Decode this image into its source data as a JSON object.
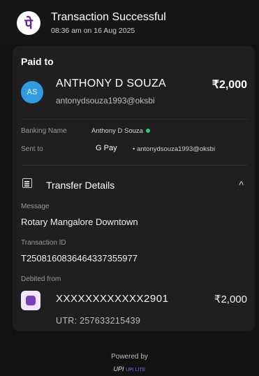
{
  "header": {
    "title": "Transaction Successful",
    "datetime": "08:36 am on 16 Aug 2025",
    "logo_letter": "पे",
    "logo_icon": "phonepe-logo-icon"
  },
  "paid_to": {
    "label": "Paid to",
    "avatar_initials": "AS",
    "name": "ANTHONY D SOUZA",
    "vpa": "antonydsouza1993@oksbi",
    "amount": "₹2,000"
  },
  "details": {
    "banking_name_label": "Banking Name",
    "banking_name_value": "Anthony D Souza",
    "sent_to_label": "Sent to",
    "sent_to_app": "G Pay",
    "sent_to_vpa": "• antonydsouza1993@oksbi"
  },
  "transfer": {
    "title": "Transfer Details",
    "chevron": "^",
    "message_label": "Message",
    "message_value": "Rotary Mangalore Downtown",
    "txn_id_label": "Transaction ID",
    "txn_id_value": "T2508160836464337355977",
    "debited_label": "Debited from",
    "account": "XXXXXXXXXXXX2901",
    "debit_amount": "₹2,000",
    "utr": "UTR: 257633215439"
  },
  "footer": {
    "powered_by": "Powered by",
    "upi_text": "UPI",
    "upi_sub": "UPI LITE"
  },
  "colors": {
    "background": "#121212",
    "card": "#1f1f1f",
    "avatar": "#2f9be0",
    "brand": "#5f259f",
    "verified": "#2ecc71"
  }
}
